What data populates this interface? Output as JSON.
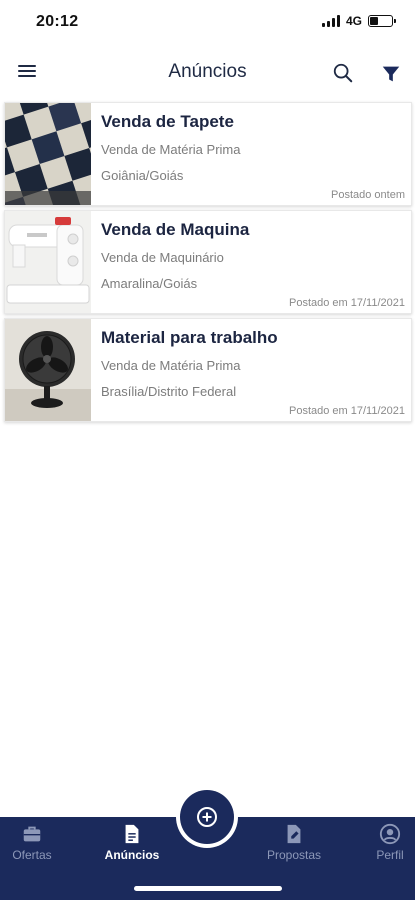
{
  "status_bar": {
    "time": "20:12",
    "network": "4G"
  },
  "app_bar": {
    "title": "Anúncios",
    "icons": [
      "menu-icon",
      "search-icon",
      "filter-icon"
    ]
  },
  "listings": [
    {
      "title": "Venda de Tapete",
      "category": "Venda de Matéria Prima",
      "location": "Goiânia/Goiás",
      "posted": "Postado ontem",
      "image": "rug-photo"
    },
    {
      "title": "Venda de Maquina",
      "category": "Venda de Maquinário",
      "location": "Amaralina/Goiás",
      "posted": "Postado em 17/11/2021",
      "image": "sewing-machine-photo"
    },
    {
      "title": "Material para trabalho",
      "category": "Venda de Matéria Prima",
      "location": "Brasília/Distrito Federal",
      "posted": "Postado em 17/11/2021",
      "image": "fan-photo"
    }
  ],
  "bottom_nav": {
    "items": [
      {
        "label": "Ofertas",
        "icon": "briefcase-icon",
        "active": false
      },
      {
        "label": "Anúncios",
        "icon": "document-icon",
        "active": true
      },
      {
        "label": "Propostas",
        "icon": "file-edit-icon",
        "active": false
      },
      {
        "label": "Perfil",
        "icon": "user-circle-icon",
        "active": false
      }
    ],
    "fab_icon": "plus-circle-icon"
  },
  "colors": {
    "primary": "#1b2a5c",
    "text_dark": "#1c2541",
    "text_muted": "#7c7c7c",
    "nav_inactive": "#8d98b8"
  }
}
